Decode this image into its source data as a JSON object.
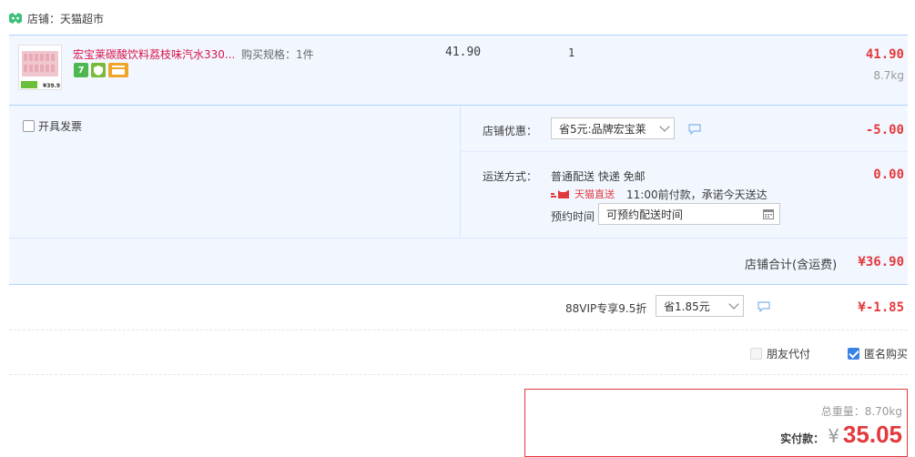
{
  "store": {
    "prefix": "店铺：",
    "name": "天猫超市"
  },
  "item": {
    "title": "宏宝莱碳酸饮料荔枝味汽水330...",
    "spec_label": "购买规格：",
    "spec_value": "1件",
    "unit_price": "41.90",
    "quantity": "1",
    "subtotal": "41.90",
    "weight": "8.7kg",
    "thumb_price": "¥39.9",
    "tags": [
      "7",
      "shield",
      "card"
    ]
  },
  "invoice": {
    "label": "开具发票"
  },
  "shop_discount": {
    "label": "店铺优惠：",
    "selected": "省5元:品牌宏宝莱",
    "amount": "-5.00"
  },
  "shipping": {
    "label": "运送方式：",
    "method": "普通配送 快递 免邮",
    "amount": "0.00",
    "tmall_direct": "天猫直送",
    "promise": "11:00前付款，承诺今天送达",
    "schedule_label": "预约时间",
    "schedule_placeholder": "可预约配送时间"
  },
  "shop_total": {
    "label": "店铺合计(含运费)",
    "amount": "¥36.90"
  },
  "vip": {
    "label": "88VIP专享9.5折",
    "selected": "省1.85元",
    "amount": "¥-1.85"
  },
  "options": {
    "friend_pay": "朋友代付",
    "anonymous": "匿名购买"
  },
  "summary": {
    "weight_label": "总重量：",
    "weight_value": "8.70kg",
    "pay_label": "实付款：",
    "currency": "¥",
    "pay_amount": "35.05"
  },
  "colors": {
    "accent_red": "#e4393c",
    "border_blue": "#b2d1ff",
    "band_bg": "#f2f7ff",
    "title_red": "#d9154b"
  }
}
